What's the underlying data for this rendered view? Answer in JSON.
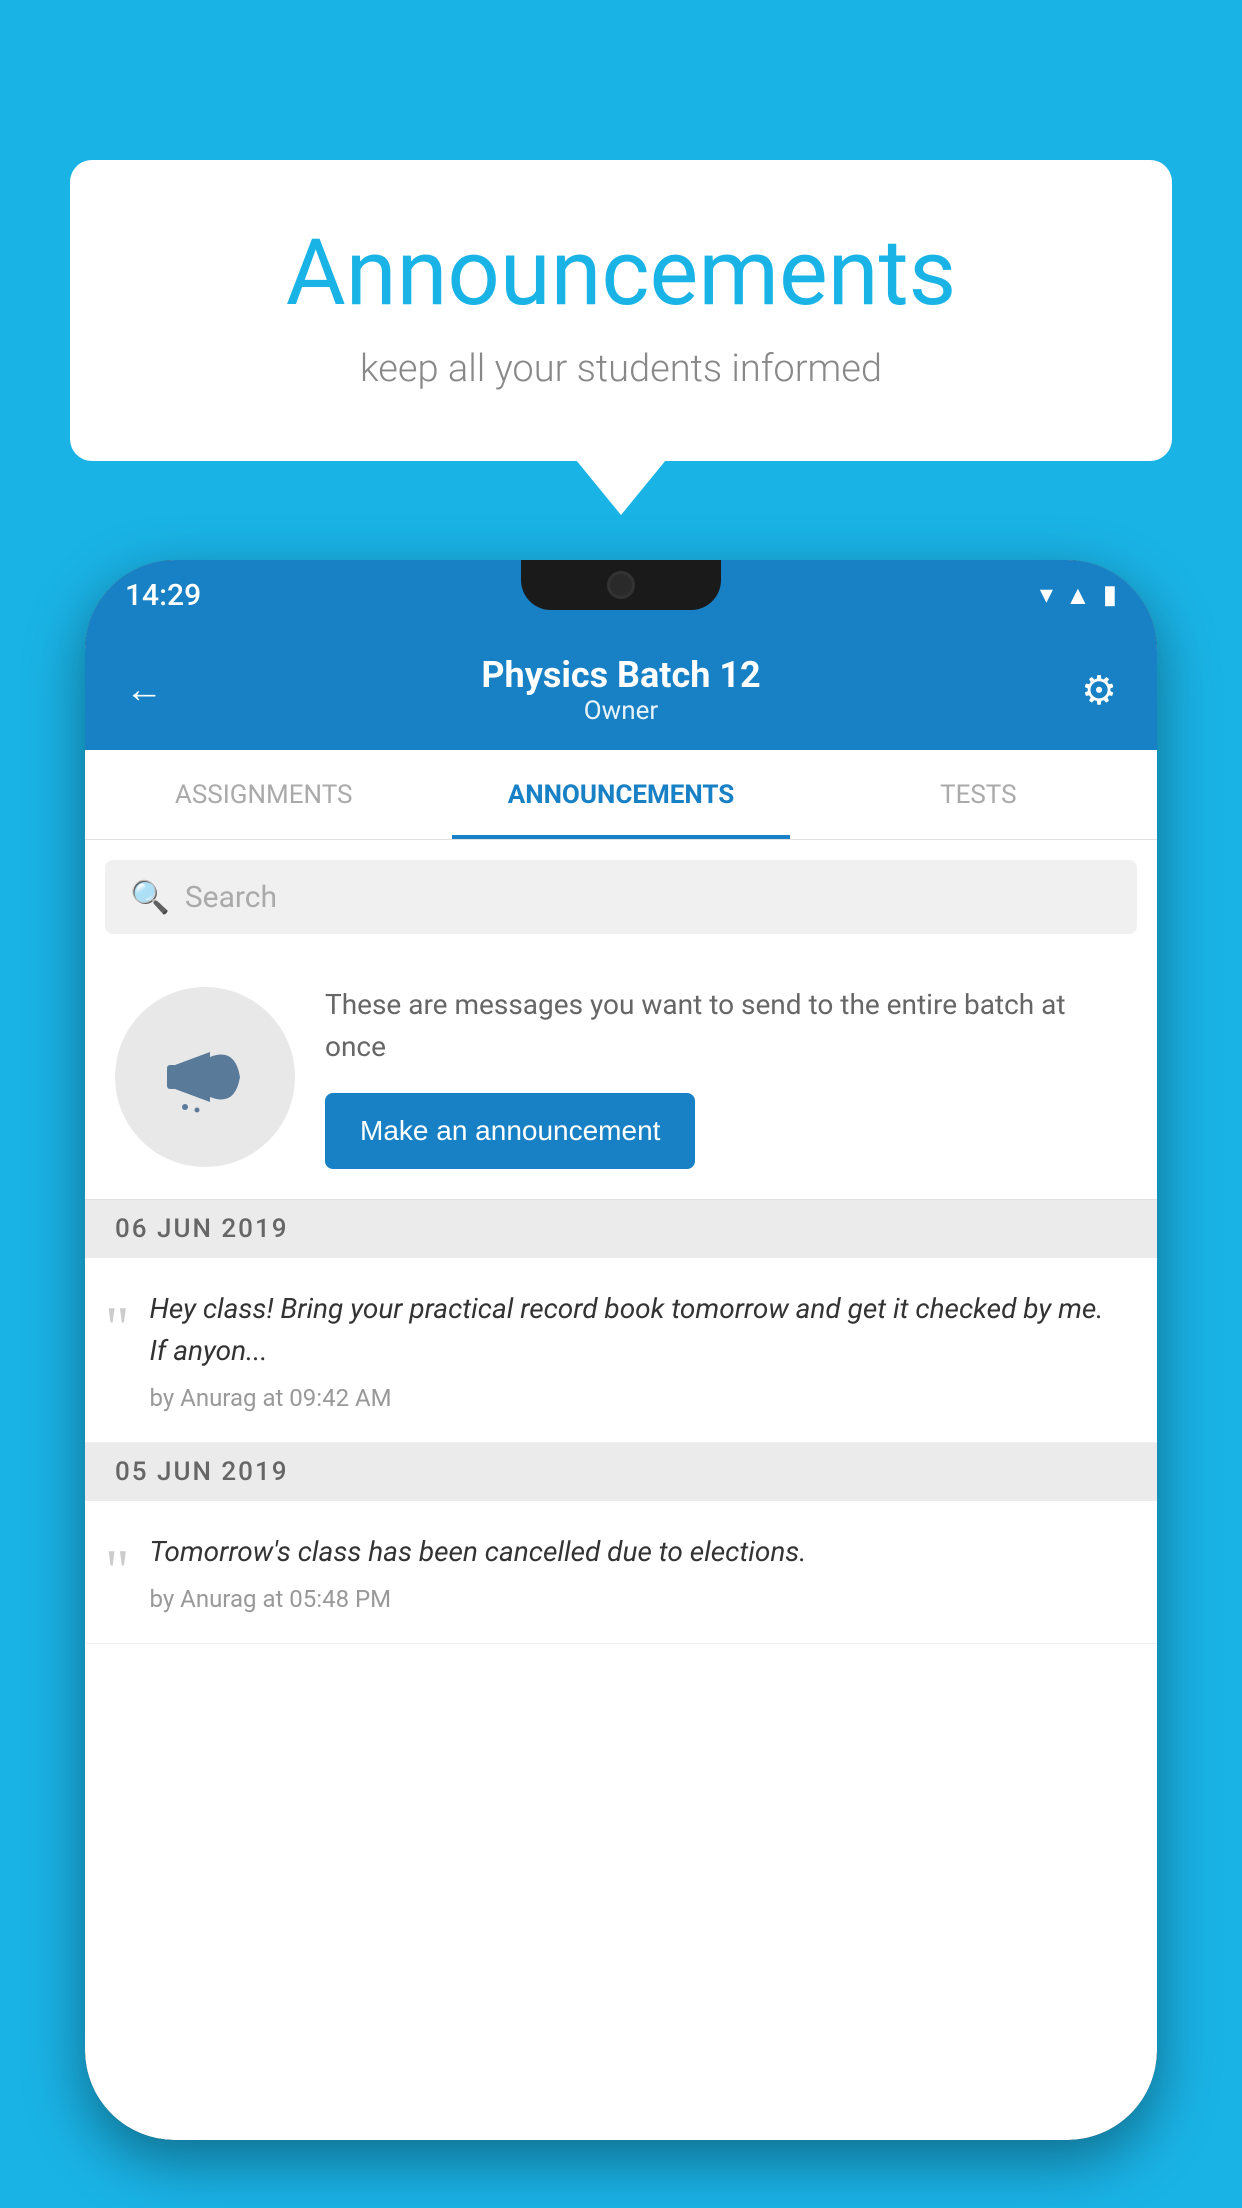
{
  "background_color": "#1ab3e6",
  "speech_bubble": {
    "title": "Announcements",
    "subtitle": "keep all your students informed"
  },
  "status_bar": {
    "time": "14:29",
    "wifi_icon": "▾",
    "signal_icon": "▲",
    "battery_icon": "▮"
  },
  "header": {
    "back_label": "←",
    "title": "Physics Batch 12",
    "subtitle": "Owner",
    "gear_label": "⚙"
  },
  "tabs": [
    {
      "label": "ASSIGNMENTS",
      "active": false
    },
    {
      "label": "ANNOUNCEMENTS",
      "active": true
    },
    {
      "label": "TESTS",
      "active": false
    }
  ],
  "search": {
    "placeholder": "Search"
  },
  "promo": {
    "description": "These are messages you want to send to the entire batch at once",
    "button_label": "Make an announcement"
  },
  "announcements": [
    {
      "date": "06  JUN  2019",
      "text": "Hey class! Bring your practical record book tomorrow and get it checked by me. If anyon...",
      "meta": "by Anurag at 09:42 AM"
    },
    {
      "date": "05  JUN  2019",
      "text": "Tomorrow's class has been cancelled due to elections.",
      "meta": "by Anurag at 05:48 PM"
    }
  ]
}
